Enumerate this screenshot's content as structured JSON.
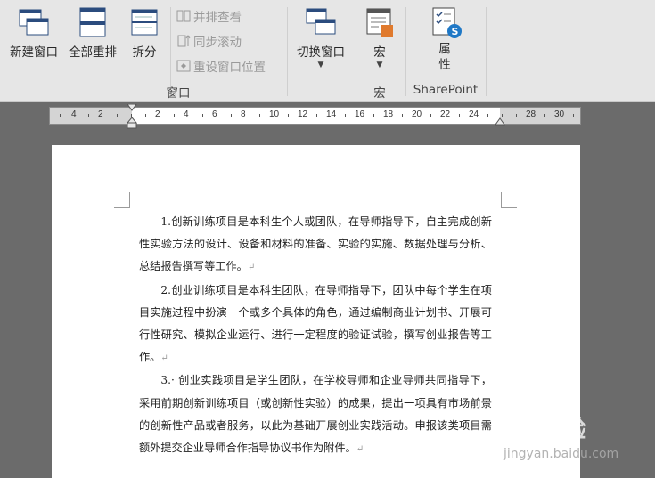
{
  "ribbon": {
    "window_group": {
      "new_window": "新建窗口",
      "arrange_all": "全部重排",
      "split": "拆分",
      "side_by_side": "并排查看",
      "sync_scroll": "同步滚动",
      "reset_position": "重设窗口位置",
      "switch_window": "切换窗口",
      "group_label": "窗口"
    },
    "macros_group": {
      "macros": "宏",
      "group_label": "宏"
    },
    "sharepoint_group": {
      "properties_line1": "属",
      "properties_line2": "性",
      "group_label": "SharePoint"
    }
  },
  "ruler": {
    "numbers": [
      "4",
      "2",
      "2",
      "4",
      "6",
      "8",
      "10",
      "12",
      "14",
      "16",
      "18",
      "20",
      "22",
      "24",
      "28",
      "30"
    ]
  },
  "document": {
    "paragraphs": [
      "1.创新训练项目是本科生个人或团队，在导师指导下，自主完成创新性实验方法的设计、设备和材料的准备、实验的实施、数据处理与分析、总结报告撰写等工作。",
      "2.创业训练项目是本科生团队，在导师指导下，团队中每个学生在项目实施过程中扮演一个或多个具体的角色，通过编制商业计划书、开展可行性研究、模拟企业运行、进行一定程度的验证试验，撰写创业报告等工作。",
      "3.· 创业实践项目是学生团队，在学校导师和企业导师共同指导下，采用前期创新训练项目（或创新性实验）的成果，提出一项具有市场前景的创新性产品或者服务，以此为基础开展创业实践活动。申报该类项目需额外提交企业导师合作指导协议书作为附件。"
    ],
    "paragraph_mark": "↵"
  },
  "watermark": {
    "brand": "Bai经验",
    "site": "jingyan.baidu.com"
  }
}
